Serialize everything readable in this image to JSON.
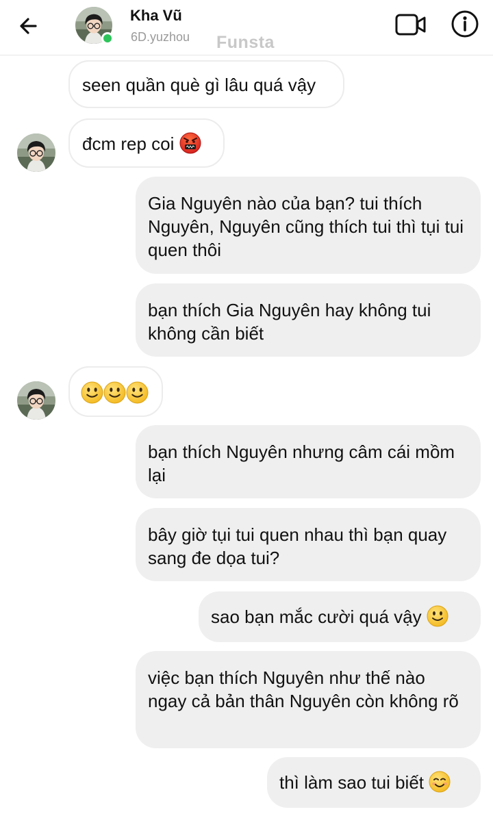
{
  "header": {
    "contact_name": "Kha Vũ",
    "contact_handle": "6D.yuzhou",
    "watermark": "Funsta",
    "icons": [
      "back-arrow-icon",
      "video-call-icon",
      "info-icon"
    ],
    "online_status_color": "#2ec45b"
  },
  "messages": [
    {
      "side": "in",
      "text": "seen quần què gì lâu quá vậy"
    },
    {
      "side": "in",
      "text": "đcm rep coi",
      "emoji": "angry-face-with-symbols"
    },
    {
      "side": "out",
      "text": "Gia Nguyên nào của bạn? tui thích Nguyên, Nguyên cũng thích tui thì tụi tui quen thôi"
    },
    {
      "side": "out",
      "text": "bạn thích Gia Nguyên hay không tui không cần biết"
    },
    {
      "side": "in",
      "text": "",
      "emoji": "slightly-smiling-face x3"
    },
    {
      "side": "out",
      "text": "bạn thích Nguyên nhưng câm cái mồm lại"
    },
    {
      "side": "out",
      "text": "bây giờ tụi tui quen nhau thì bạn quay sang đe dọa tui?"
    },
    {
      "side": "out",
      "text": "sao bạn mắc cười quá vậy",
      "emoji": "slightly-smiling-face"
    },
    {
      "side": "out",
      "text": "việc bạn thích Nguyên như thế nào ngay cả bản thân Nguyên còn không rõ"
    },
    {
      "side": "out",
      "text": "thì làm sao tui biết",
      "emoji": "smiling-face-with-smiling-eyes"
    }
  ],
  "colors": {
    "incoming_bubble": "#ffffff",
    "outgoing_bubble": "#efefef",
    "emoji_yellow": "#f7c530"
  }
}
